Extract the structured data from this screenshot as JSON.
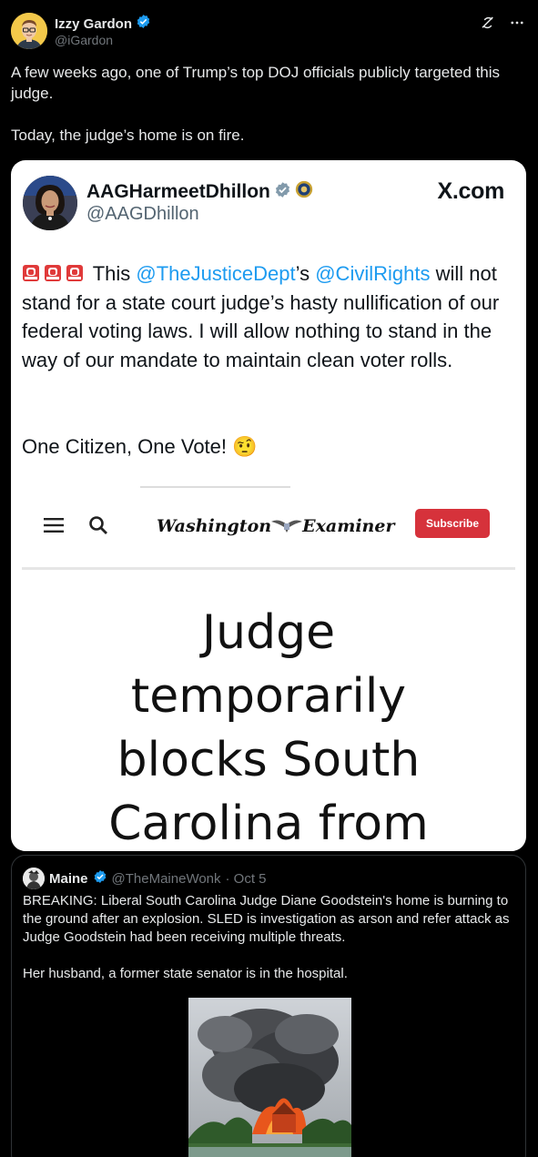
{
  "author": {
    "name": "Izzy Gardon",
    "handle": "@iGardon"
  },
  "post": {
    "paragraphs": [
      "A few weeks ago, one of Trump’s top DOJ officials publicly targeted this judge.",
      "Today, the judge’s home is on fire."
    ]
  },
  "screenshot": {
    "name": "AAGHarmeetDhillon",
    "handle": "@AAGDhillon",
    "brand": "X.com",
    "body_pre": "This",
    "mention1": "@TheJusticeDept",
    "body_mid": "’s",
    "mention2": "@CivilRights",
    "body_post": "will not stand for a state court judge’s hasty nullification of our federal voting laws. I will allow nothing to stand in the way of our mandate to maintain clean voter rolls.",
    "closing": "One Citizen, One Vote! 🤨",
    "article": {
      "logo_left": "Washington",
      "logo_right": "Examiner",
      "subscribe": "Subscribe",
      "headline": [
        "Judge",
        "temporarily",
        "blocks South",
        "Carolina from"
      ]
    }
  },
  "quote": {
    "name": "Maine",
    "handle": "@TheMaineWonk",
    "date": "· Oct 5",
    "paragraphs": [
      "BREAKING:  Liberal South Carolina Judge Diane Goodstein's home is burning to the ground after an explosion. SLED is investigation as arson and refer attack as Judge Goodstein had been receiving multiple threats.",
      "Her husband, a former state senator is in the hospital."
    ]
  },
  "colors": {
    "background": "#000000",
    "text": "#e7e9ea",
    "muted": "#71767b",
    "link": "#1d9bf0",
    "verified": "#1d9bf0",
    "subscribe": "#d6323b"
  }
}
